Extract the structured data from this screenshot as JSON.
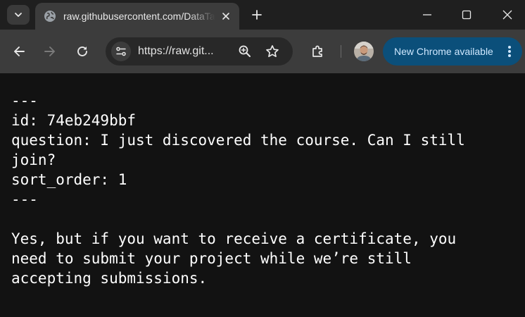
{
  "tab": {
    "title": "raw.githubusercontent.com/DataTalksClub"
  },
  "toolbar": {
    "url": "https://raw.git..."
  },
  "update": {
    "label": "New Chrome available"
  },
  "content": {
    "lines": [
      "---",
      "id: 74eb249bbf",
      "question: I just discovered the course. Can I still",
      "join?",
      "sort_order: 1",
      "---",
      "",
      "Yes, but if you want to receive a certificate, you",
      "need to submit your project while we’re still",
      "accepting submissions."
    ]
  },
  "colors": {
    "page_background": "#121212",
    "tab_strip": "#1f1f1f",
    "toolbar": "#3c3c3c",
    "update_pill": "#0b4f7a",
    "text": "#ffffff"
  },
  "icons": [
    "tab-search-icon",
    "globe-icon",
    "close-icon",
    "plus-icon",
    "minimize-icon",
    "maximize-icon",
    "window-close-icon",
    "back-arrow-icon",
    "forward-arrow-icon",
    "reload-icon",
    "site-info-icon",
    "zoom-icon",
    "star-icon",
    "extensions-icon",
    "kebab-menu-icon"
  ]
}
